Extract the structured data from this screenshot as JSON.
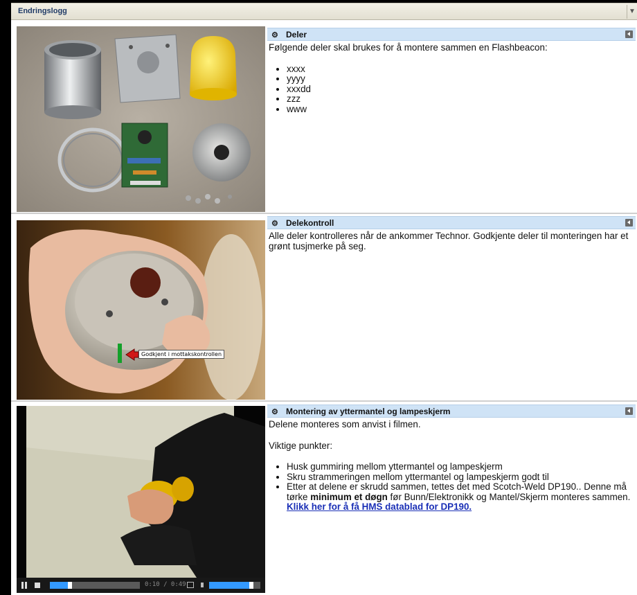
{
  "header": {
    "title": "Endringslogg"
  },
  "sections": [
    {
      "title": "Deler",
      "intro": "Følgende deler skal brukes for å montere sammen en Flashbeacon:",
      "items": [
        "xxxx",
        "yyyy",
        "xxxdd",
        "zzz",
        "www"
      ]
    },
    {
      "title": "Delekontroll",
      "text": "Alle deler kontrolleres når de ankommer Technor.  Godkjente deler til monteringen har et grønt tusjmerke på seg.",
      "callout": "Godkjent i mottakskontrollen"
    },
    {
      "title": "Montering av yttermantel og lampeskjerm",
      "p1": "Delene monteres som anvist i filmen.",
      "p2": "Viktige punkter:",
      "item1": "Husk gummiring mellom yttermantel og lampeskjerm",
      "item2": "Skru strammeringen mellom yttermantel og lampeskjerm godt til",
      "item3_a": "Etter at delene er skrudd sammen, tettes det med Scotch-Weld DP190.. Denne må tørke ",
      "item3_b": "minimum et døgn",
      "item3_c": " før Bunn/Elektronikk og Mantel/Skjerm monteres sammen.  ",
      "link": "Klikk her for å få HMS datablad for DP190."
    }
  ],
  "video": {
    "time": "0:10 / 0:49",
    "progress": 0.2,
    "volume": 0.8
  }
}
